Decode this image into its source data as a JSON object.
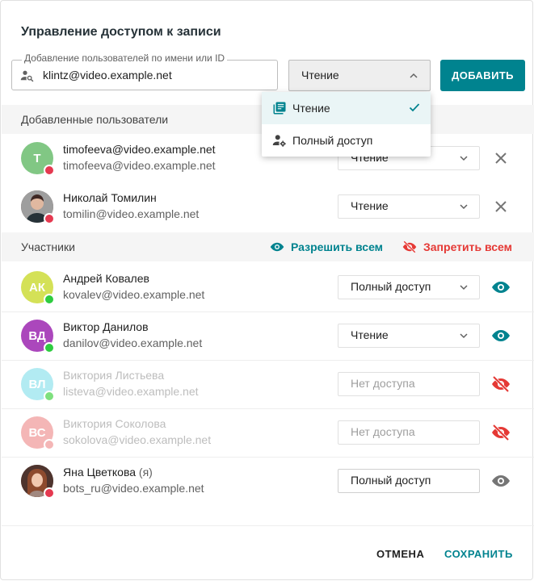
{
  "dialog": {
    "title": "Управление доступом к записи"
  },
  "add_user": {
    "field_label": "Добавление пользователей по имени или ID",
    "field_value": "klintz@video.example.net",
    "role_value": "Чтение",
    "add_button": "ДОБАВИТЬ"
  },
  "role_menu": {
    "items": [
      {
        "label": "Чтение",
        "icon": "library-books-icon",
        "selected": true
      },
      {
        "label": "Полный доступ",
        "icon": "person-gear-icon",
        "selected": false
      }
    ]
  },
  "added_section": {
    "title": "Добавленные пользователи",
    "users": [
      {
        "initials": "T",
        "name": "timofeeva@video.example.net",
        "email": "timofeeva@video.example.net",
        "role": "Чтение",
        "avatar_color": "#81c784",
        "status_color": "#e53950"
      },
      {
        "initials": "",
        "name": "Николай Томилин",
        "email": "tomilin@video.example.net",
        "role": "Чтение",
        "avatar_color": "#5d4037",
        "status_color": "#e53950"
      }
    ]
  },
  "participants": {
    "title": "Участники",
    "allow_all": "Разрешить всем",
    "deny_all": "Запретить всем",
    "users": [
      {
        "initials": "АК",
        "name": "Андрей Ковалев",
        "email": "kovalev@video.example.net",
        "role": "Полный доступ",
        "avatar_color": "#d4e157",
        "status_color": "#2ecc40",
        "visible": true
      },
      {
        "initials": "ВД",
        "name": "Виктор Данилов",
        "email": "danilov@video.example.net",
        "role": "Чтение",
        "avatar_color": "#ab47bc",
        "status_color": "#2ecc40",
        "visible": true
      },
      {
        "initials": "ВЛ",
        "name": "Виктория Листьева",
        "email": "listeva@video.example.net",
        "role": "Нет доступа",
        "avatar_color": "#b2ebf2",
        "status_color": "#7ee07e",
        "visible": false
      },
      {
        "initials": "ВС",
        "name": "Виктория Соколова",
        "email": "sokolova@video.example.net",
        "role": "Нет доступа",
        "avatar_color": "#f4b6b6",
        "status_color": "#f4b6b6",
        "visible": false
      },
      {
        "initials": "",
        "name": "Яна Цветкова",
        "name_suffix": "(я)",
        "email": "bots_ru@video.example.net",
        "role": "Полный доступ",
        "avatar_color": "#6d4c41",
        "status_color": "#e53950",
        "visible": true
      }
    ]
  },
  "footer": {
    "cancel": "ОТМЕНА",
    "save": "СОХРАНИТЬ"
  },
  "colors": {
    "accent": "#00838f",
    "danger": "#e53935"
  }
}
